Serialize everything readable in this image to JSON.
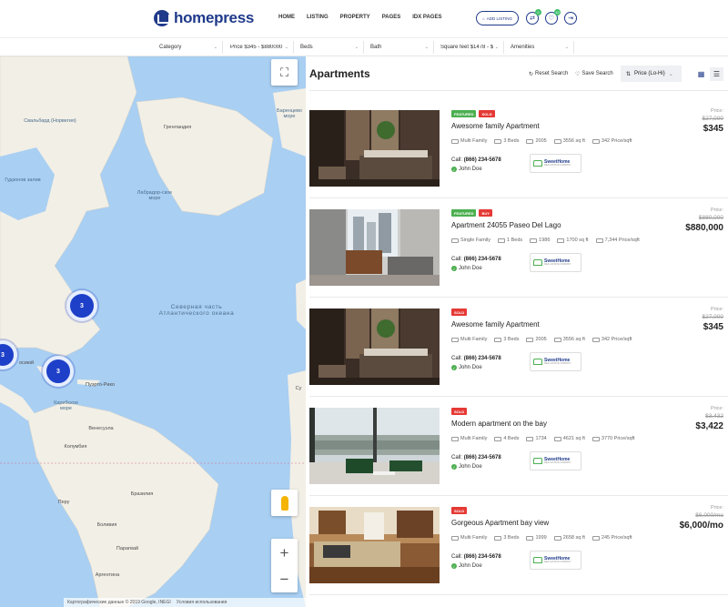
{
  "header": {
    "logo_text": "homepress",
    "nav": [
      "HOME",
      "LISTING",
      "PROPERTY",
      "PAGES",
      "IDX PAGES"
    ],
    "add_listing": "ADD LISTING",
    "compare_count": "0",
    "favorites_count": "10"
  },
  "filters": [
    {
      "label": "Category"
    },
    {
      "label": "Price $345 - $880000"
    },
    {
      "label": "Beds"
    },
    {
      "label": "Bath"
    },
    {
      "label": "Square feet $1478 - $"
    },
    {
      "label": "Amenities"
    }
  ],
  "map": {
    "labels": {
      "svalbard": "Свальбард (Норвегия)",
      "barents": "Баренцево море",
      "greenland": "Гренландия",
      "hudson": "Гудзонов залив",
      "labrador": "Лабрадор-ское море",
      "north_atlantic": "Северная часть Атлантического океана",
      "puerto_rico": "Пуэрто-Рико",
      "caribbean": "Карибское море",
      "venezuela": "Венесуэла",
      "colombia": "Колумбия",
      "peru": "Перу",
      "brazil": "Бразилия",
      "bolivia": "Боливия",
      "paraguay": "Парагвай",
      "argentina": "Аргентина",
      "osiyaii": "осиюй",
      "sudan": "Су"
    },
    "clusters": [
      "3",
      "3",
      "3"
    ],
    "footer_data": "Картографические данные © 2019 Google, INEGI",
    "footer_terms": "Условия использования",
    "zoom_in": "+",
    "zoom_out": "−"
  },
  "panel": {
    "title": "Apartments",
    "reset_search": "Reset Search",
    "save_search": "Save Search",
    "sort": "Price (Lo-Hi)"
  },
  "listings": [
    {
      "badges": [
        "FEATURED",
        "SOLD"
      ],
      "title": "Awesome family Apartment",
      "type": "Multi Family",
      "beds": "3 Beds",
      "year": "2005",
      "sqft": "3556 sq ft",
      "pps": "342 Price/sqft",
      "call_label": "Call:",
      "phone": "(866) 234-5678",
      "agent": "John Doe",
      "company": "SweetHome",
      "company_sub": "REAL ESTATE COMPANY",
      "price_label": "Price:",
      "old_price": "$27,000",
      "price": "$345"
    },
    {
      "badges": [
        "FEATURED",
        "BUY"
      ],
      "title": "Apartment 24055 Paseo Del Lago",
      "type": "Single Family",
      "beds": "1 Beds",
      "year": "1986",
      "sqft": "1700 sq ft",
      "pps": "7,344 Price/sqft",
      "call_label": "Call:",
      "phone": "(866) 234-5678",
      "agent": "John Doe",
      "company": "SweetHome",
      "company_sub": "REAL ESTATE COMPANY",
      "price_label": "Price:",
      "old_price": "$880,000",
      "price": "$880,000"
    },
    {
      "badges": [
        "SOLD"
      ],
      "title": "Awesome family Apartment",
      "type": "Multi Family",
      "beds": "3 Beds",
      "year": "2005",
      "sqft": "3556 sq ft",
      "pps": "342 Price/sqft",
      "call_label": "Call:",
      "phone": "(866) 234-5678",
      "agent": "John Doe",
      "company": "SweetHome",
      "company_sub": "REAL ESTATE COMPANY",
      "price_label": "Price:",
      "old_price": "$27,000",
      "price": "$345"
    },
    {
      "badges": [
        "SOLD"
      ],
      "title": "Modern apartment on the bay",
      "type": "Multi Family",
      "beds": "4 Beds",
      "year": "1734",
      "sqft": "4621 sq ft",
      "pps": "3770 Price/sqft",
      "call_label": "Call:",
      "phone": "(866) 234-5678",
      "agent": "John Doe",
      "company": "SweetHome",
      "company_sub": "REAL ESTATE COMPANY",
      "price_label": "Price:",
      "old_price": "$3,432",
      "price": "$3,422"
    },
    {
      "badges": [
        "SOLD"
      ],
      "title": "Gorgeous Apartment bay view",
      "type": "Multi Family",
      "beds": "3 Beds",
      "year": "1999",
      "sqft": "2658 sq ft",
      "pps": "245 Price/sqft",
      "call_label": "Call:",
      "phone": "(866) 234-5678",
      "agent": "John Doe",
      "company": "SweetHome",
      "company_sub": "REAL ESTATE COMPANY",
      "price_label": "Price:",
      "old_price": "$6,000/mo",
      "price": "$6,000/mo"
    }
  ],
  "colors": {
    "brand": "#1f3a8a",
    "cluster": "#1e40c8",
    "sold": "#e53935",
    "featured": "#4caf50"
  }
}
